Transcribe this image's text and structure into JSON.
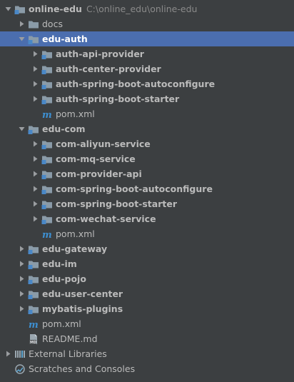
{
  "tree": [
    {
      "name": "online-edu",
      "path": "C:\\online_edu\\online-edu",
      "depth": 0,
      "arrow": "down",
      "icon": "module-folder",
      "bold": true,
      "selected": false
    },
    {
      "name": "docs",
      "depth": 1,
      "arrow": "right",
      "icon": "folder",
      "bold": false,
      "selected": false
    },
    {
      "name": "edu-auth",
      "depth": 1,
      "arrow": "down",
      "icon": "module-folder",
      "bold": true,
      "selected": true
    },
    {
      "name": "auth-api-provider",
      "depth": 2,
      "arrow": "right",
      "icon": "module-folder",
      "bold": true,
      "selected": false
    },
    {
      "name": "auth-center-provider",
      "depth": 2,
      "arrow": "right",
      "icon": "module-folder",
      "bold": true,
      "selected": false
    },
    {
      "name": "auth-spring-boot-autoconfigure",
      "depth": 2,
      "arrow": "right",
      "icon": "module-folder",
      "bold": true,
      "selected": false
    },
    {
      "name": "auth-spring-boot-starter",
      "depth": 2,
      "arrow": "right",
      "icon": "module-folder",
      "bold": true,
      "selected": false
    },
    {
      "name": "pom.xml",
      "depth": 2,
      "arrow": "none",
      "icon": "maven",
      "bold": false,
      "selected": false
    },
    {
      "name": "edu-com",
      "depth": 1,
      "arrow": "down",
      "icon": "module-folder",
      "bold": true,
      "selected": false
    },
    {
      "name": "com-aliyun-service",
      "depth": 2,
      "arrow": "right",
      "icon": "module-folder",
      "bold": true,
      "selected": false
    },
    {
      "name": "com-mq-service",
      "depth": 2,
      "arrow": "right",
      "icon": "module-folder",
      "bold": true,
      "selected": false
    },
    {
      "name": "com-provider-api",
      "depth": 2,
      "arrow": "right",
      "icon": "module-folder",
      "bold": true,
      "selected": false
    },
    {
      "name": "com-spring-boot-autoconfigure",
      "depth": 2,
      "arrow": "right",
      "icon": "module-folder",
      "bold": true,
      "selected": false
    },
    {
      "name": "com-spring-boot-starter",
      "depth": 2,
      "arrow": "right",
      "icon": "module-folder",
      "bold": true,
      "selected": false
    },
    {
      "name": "com-wechat-service",
      "depth": 2,
      "arrow": "right",
      "icon": "module-folder",
      "bold": true,
      "selected": false
    },
    {
      "name": "pom.xml",
      "depth": 2,
      "arrow": "none",
      "icon": "maven",
      "bold": false,
      "selected": false
    },
    {
      "name": "edu-gateway",
      "depth": 1,
      "arrow": "right",
      "icon": "module-folder",
      "bold": true,
      "selected": false
    },
    {
      "name": "edu-im",
      "depth": 1,
      "arrow": "right",
      "icon": "module-folder",
      "bold": true,
      "selected": false
    },
    {
      "name": "edu-pojo",
      "depth": 1,
      "arrow": "right",
      "icon": "module-folder",
      "bold": true,
      "selected": false
    },
    {
      "name": "edu-user-center",
      "depth": 1,
      "arrow": "right",
      "icon": "module-folder",
      "bold": true,
      "selected": false
    },
    {
      "name": "mybatis-plugins",
      "depth": 1,
      "arrow": "right",
      "icon": "module-folder",
      "bold": true,
      "selected": false
    },
    {
      "name": "pom.xml",
      "depth": 1,
      "arrow": "none",
      "icon": "maven",
      "bold": false,
      "selected": false
    },
    {
      "name": "README.md",
      "depth": 1,
      "arrow": "none",
      "icon": "markdown",
      "bold": false,
      "selected": false
    },
    {
      "name": "External Libraries",
      "depth": 0,
      "arrow": "right",
      "icon": "libraries",
      "bold": false,
      "selected": false
    },
    {
      "name": "Scratches and Consoles",
      "depth": 0,
      "arrow": "none",
      "icon": "scratches",
      "bold": false,
      "selected": false
    }
  ],
  "colors": {
    "background": "#3c3f41",
    "selection": "#4b6eaf",
    "text": "#bbbbbb",
    "path_text": "#8a8a8a",
    "folder": "#8a9ba8",
    "module_marker": "#4a88c7",
    "maven_icon": "#3d8fd1"
  }
}
